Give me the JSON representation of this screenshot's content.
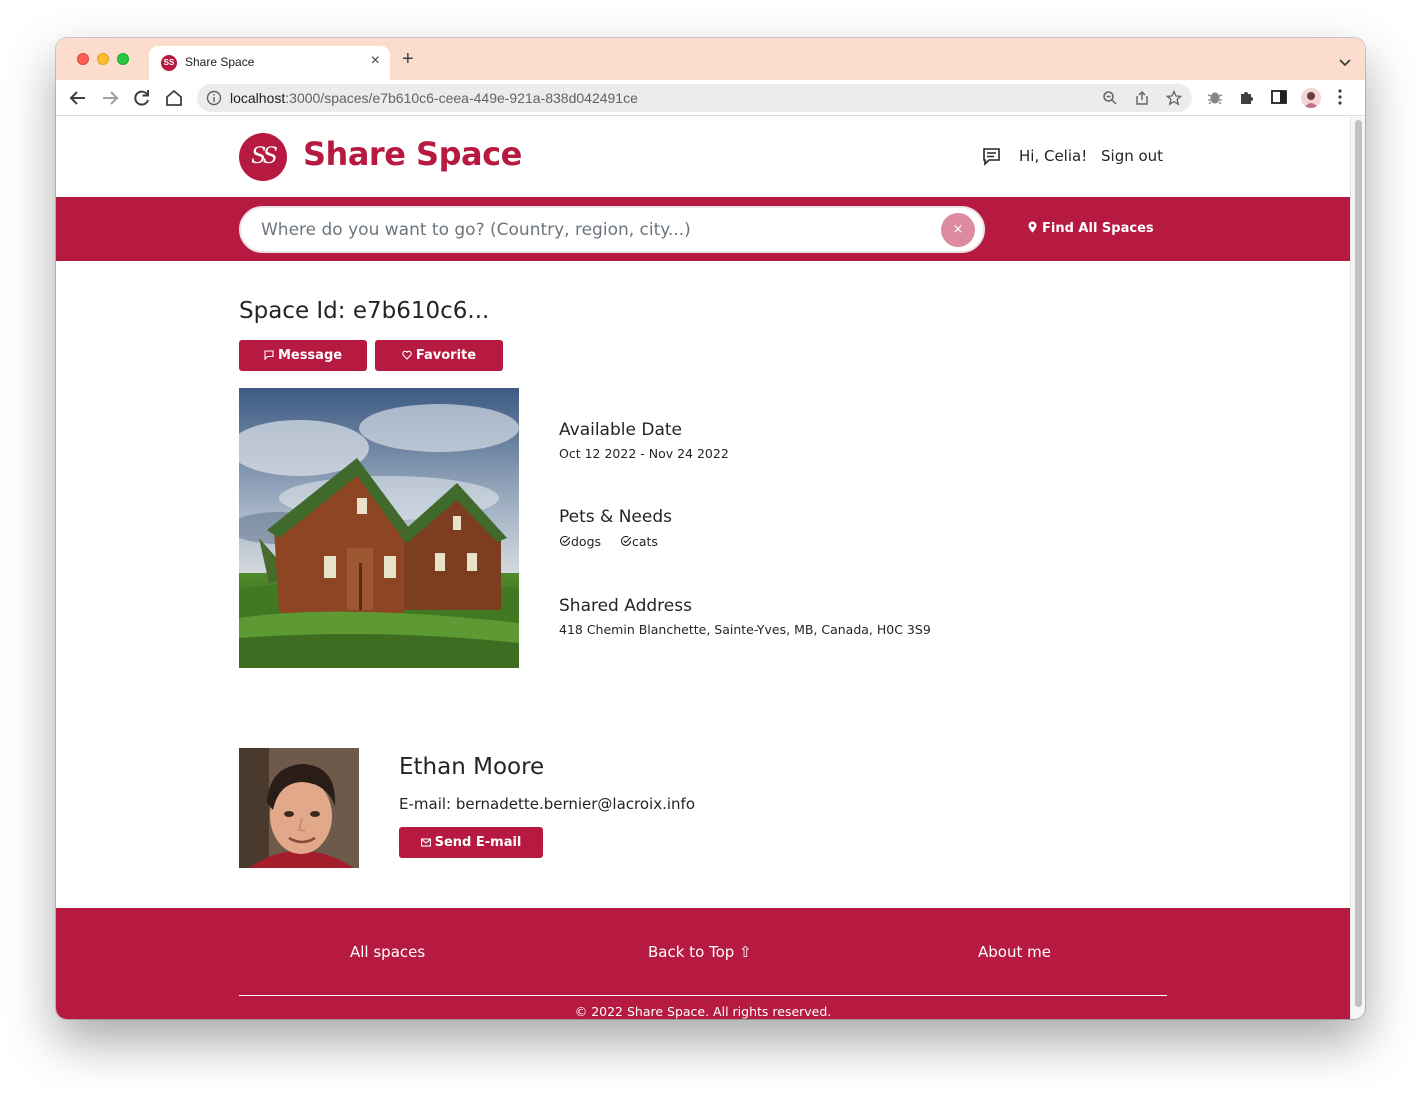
{
  "browser": {
    "tab_title": "Share Space",
    "tab_close": "×",
    "new_tab": "+",
    "url_host": "localhost",
    "url_path": ":3000/spaces/e7b610c6-ceea-449e-921a-838d042491ce"
  },
  "header": {
    "logo_text": "SS",
    "brand": "Share Space",
    "greeting": "Hi, Celia!",
    "sign_out": "Sign out"
  },
  "search": {
    "placeholder": "Where do you want to go? (Country, region, city...)",
    "clear": "×",
    "find_all": "Find All Spaces"
  },
  "space": {
    "title": "Space Id: e7b610c6...",
    "message_btn": "Message",
    "favorite_btn": "Favorite",
    "available_heading": "Available Date",
    "available_value": "Oct 12 2022 - Nov 24 2022",
    "pets_heading": "Pets & Needs",
    "pets": [
      "dogs",
      "cats"
    ],
    "address_heading": "Shared Address",
    "address_value": "418 Chemin Blanchette, Sainte-Yves, MB, Canada, H0C 3S9"
  },
  "host": {
    "name": "Ethan Moore",
    "email": "E-mail: bernadette.bernier@lacroix.info",
    "send_btn": "Send E-mail"
  },
  "footer": {
    "all_spaces": "All spaces",
    "back_to_top": "Back to Top ⇧",
    "about_me": "About me",
    "copyright": "© 2022 Share Space. All rights reserved."
  },
  "colors": {
    "brand": "#b71a41",
    "tabstrip": "#fcdccd",
    "clear_button": "#dc8ba0"
  }
}
